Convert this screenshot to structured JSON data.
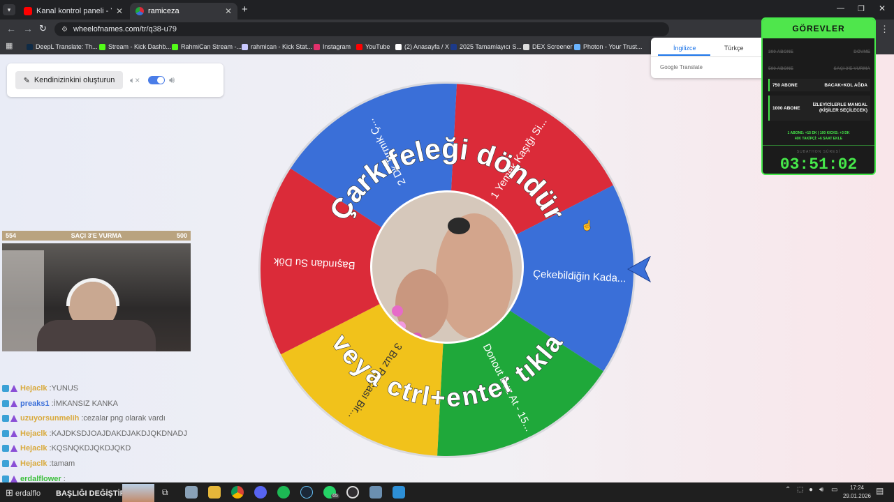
{
  "browser": {
    "tabs": [
      {
        "title": "Kanal kontrol paneli - YouTube",
        "active": false,
        "favicon_color": "#ff0000"
      },
      {
        "title": "ramiceza",
        "active": true,
        "favicon_color": "#4aa3ff"
      }
    ],
    "new_tab": "+",
    "url": "wheelofnames.com/tr/q38-u79",
    "bookmarks": [
      {
        "label": "DeepL Translate: Th...",
        "color": "#0f2b46"
      },
      {
        "label": "Stream - Kick Dashb...",
        "color": "#53fc18"
      },
      {
        "label": "RahmiCan Stream -...",
        "color": "#53fc18"
      },
      {
        "label": "rahmican - Kick Stat...",
        "color": "#c9c9ff"
      },
      {
        "label": "Instagram",
        "color": "#e1306c"
      },
      {
        "label": "YouTube",
        "color": "#ff0000"
      },
      {
        "label": "(2) Anasayfa / X",
        "color": "#ffffff"
      },
      {
        "label": "2025 Tamamlayıcı S...",
        "color": "#1c3a8a"
      },
      {
        "label": "DEX Screener",
        "color": "#dddddd"
      },
      {
        "label": "Photon - Your Trust...",
        "color": "#6ab4ff"
      }
    ]
  },
  "controls": {
    "create_label": "Kendinizinkini oluşturun"
  },
  "translate_popup": {
    "tabs": [
      "İngilizce",
      "Türkçe"
    ],
    "footer": "Google Translate"
  },
  "gorevler": {
    "title": "GÖREVLER",
    "items": [
      {
        "goal": "300 ABONE",
        "task": "DÖVME",
        "done": true
      },
      {
        "goal": "500 ABONE",
        "task": "SAÇI 3'E VURMA",
        "done": true
      },
      {
        "goal": "750 ABONE",
        "task": "BACAK+KOL AĞDA",
        "done": false
      },
      {
        "goal": "1000 ABONE",
        "task": "İZLEYİCİLERLE MANGAL (KİŞİLER SEÇİLECEK)",
        "done": false
      }
    ],
    "note_line1": "1 ABONE: +15 DK  |  100 KICKS: +3 DK",
    "note_line2": "40K TAKİPÇİ: +6 SAAT EKLE",
    "subathon_label": "SUBATHON SÜRESİ",
    "timer": "03:51:02"
  },
  "stream_overlay": {
    "left_count": "554",
    "goal_label": "SAÇI 3'E VURMA",
    "right_count": "500"
  },
  "chat": [
    {
      "user": "Hejaclk",
      "message": "YUNUS",
      "color": "#d9a93b"
    },
    {
      "user": "preaks1",
      "message": "İMKANSIZ KANKA",
      "color": "#3b6fd9"
    },
    {
      "user": "uzuyorsunmelih",
      "message": "cezalar png olarak vardı",
      "color": "#d9a93b"
    },
    {
      "user": "Hejaclk",
      "message": "KAJDKSDJOAJDAKDJAKDJQKDNADJ",
      "color": "#d9a93b"
    },
    {
      "user": "Hejaclk",
      "message": "KQSNQKDJQKDJQKD",
      "color": "#d9a93b"
    },
    {
      "user": "Hejaclk",
      "message": "tamam",
      "color": "#d9a93b"
    },
    {
      "user": "erdalflower",
      "message": "",
      "color": "#3bbf3b"
    }
  ],
  "wheel": {
    "segments": [
      {
        "label": "1 Yemek Kaşığı Si...",
        "color": "#db2b39"
      },
      {
        "label": "Çekebildiğin Kada...",
        "color": "#3a6fd8"
      },
      {
        "label": "Donout Buz At - 15...",
        "color": "#1fa83a"
      },
      {
        "label": "3 Buz Parçası Bir...",
        "color": "#f1c21b"
      },
      {
        "label": "Başından Su Dök",
        "color": "#db2b39"
      },
      {
        "label": "2 Dk Tırmık Ç...",
        "color": "#3a6fd8"
      }
    ],
    "top_text": "Çarkıfeleği döndür",
    "bottom_text": "veya ctrl+enter tıkla"
  },
  "taskbar": {
    "title_text": "BAŞLIĞI DEĞİŞTİR",
    "user_text": "erdalflo",
    "badge": "65",
    "time": "17:24",
    "date": "29.01.2026"
  }
}
